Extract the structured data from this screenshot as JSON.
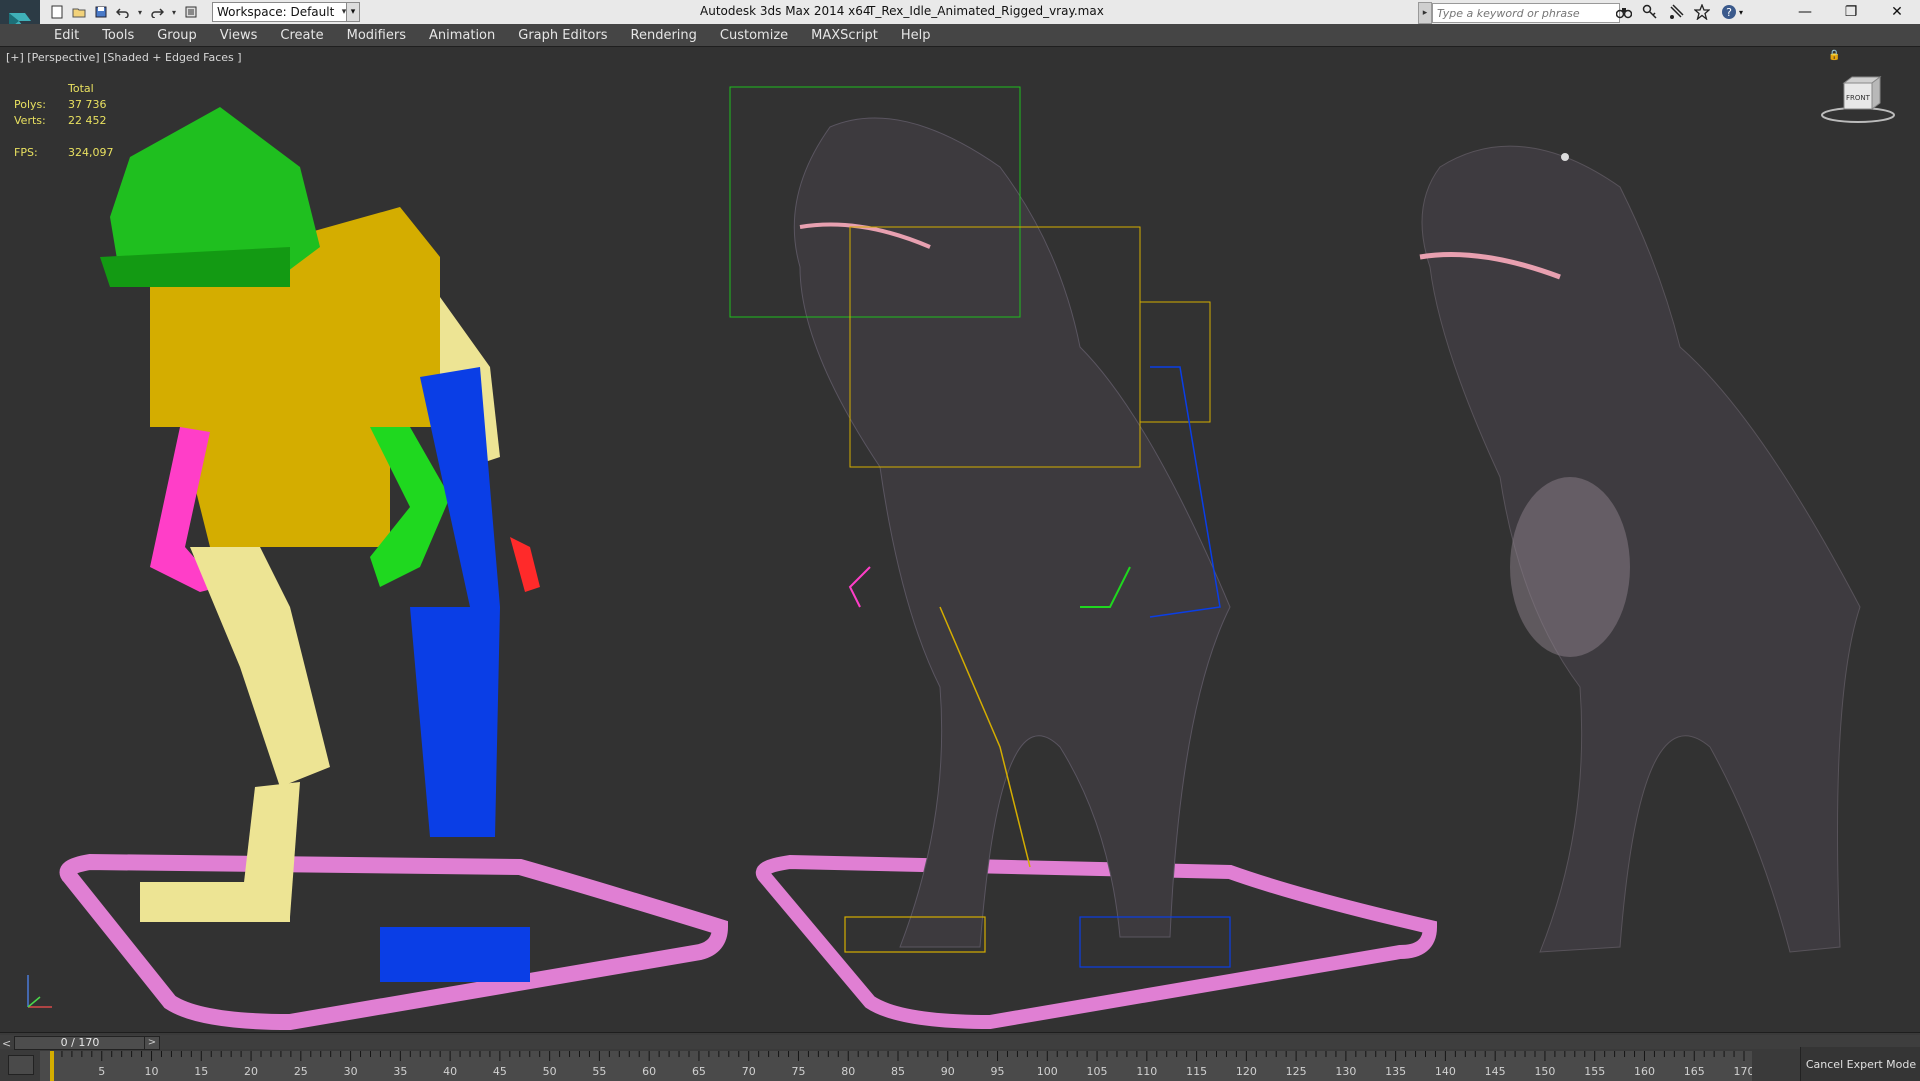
{
  "titlebar": {
    "workspace": "Workspace: Default",
    "app_title": "Autodesk 3ds Max  2014 x64",
    "file_title": "T_Rex_Idle_Animated_Rigged_vray.max",
    "search_placeholder": "Type a keyword or phrase"
  },
  "menu": {
    "items": [
      "Edit",
      "Tools",
      "Group",
      "Views",
      "Create",
      "Modifiers",
      "Animation",
      "Graph Editors",
      "Rendering",
      "Customize",
      "MAXScript",
      "Help"
    ]
  },
  "viewport": {
    "label": "[+] [Perspective] [Shaded + Edged Faces ]",
    "stats": {
      "header": "Total",
      "polys_label": "Polys:",
      "polys_value": "37 736",
      "verts_label": "Verts:",
      "verts_value": "22 452",
      "fps_label": "FPS:",
      "fps_value": "324,097"
    },
    "viewcube_face": "FRONT"
  },
  "timeline": {
    "frame_readout": "0 / 170",
    "prev_label": "<",
    "next_label": ">",
    "ticks": [
      5,
      10,
      15,
      20,
      25,
      30,
      35,
      40,
      45,
      50,
      55,
      60,
      65,
      70,
      75,
      80,
      85,
      90,
      95,
      100,
      105,
      110,
      115,
      120,
      125,
      130,
      135,
      140,
      145,
      150,
      155,
      160,
      165,
      170
    ],
    "range_start": 0,
    "range_end": 170,
    "cancel_expert": "Cancel Expert Mode"
  },
  "colors": {
    "bone_green": "#1fbf1f",
    "bone_yellow": "#d4ad00",
    "bone_blue": "#0a3ee6",
    "bone_pink": "#ff3ec8",
    "footplate": "#e07fd3",
    "stats_text": "#e8e060"
  }
}
